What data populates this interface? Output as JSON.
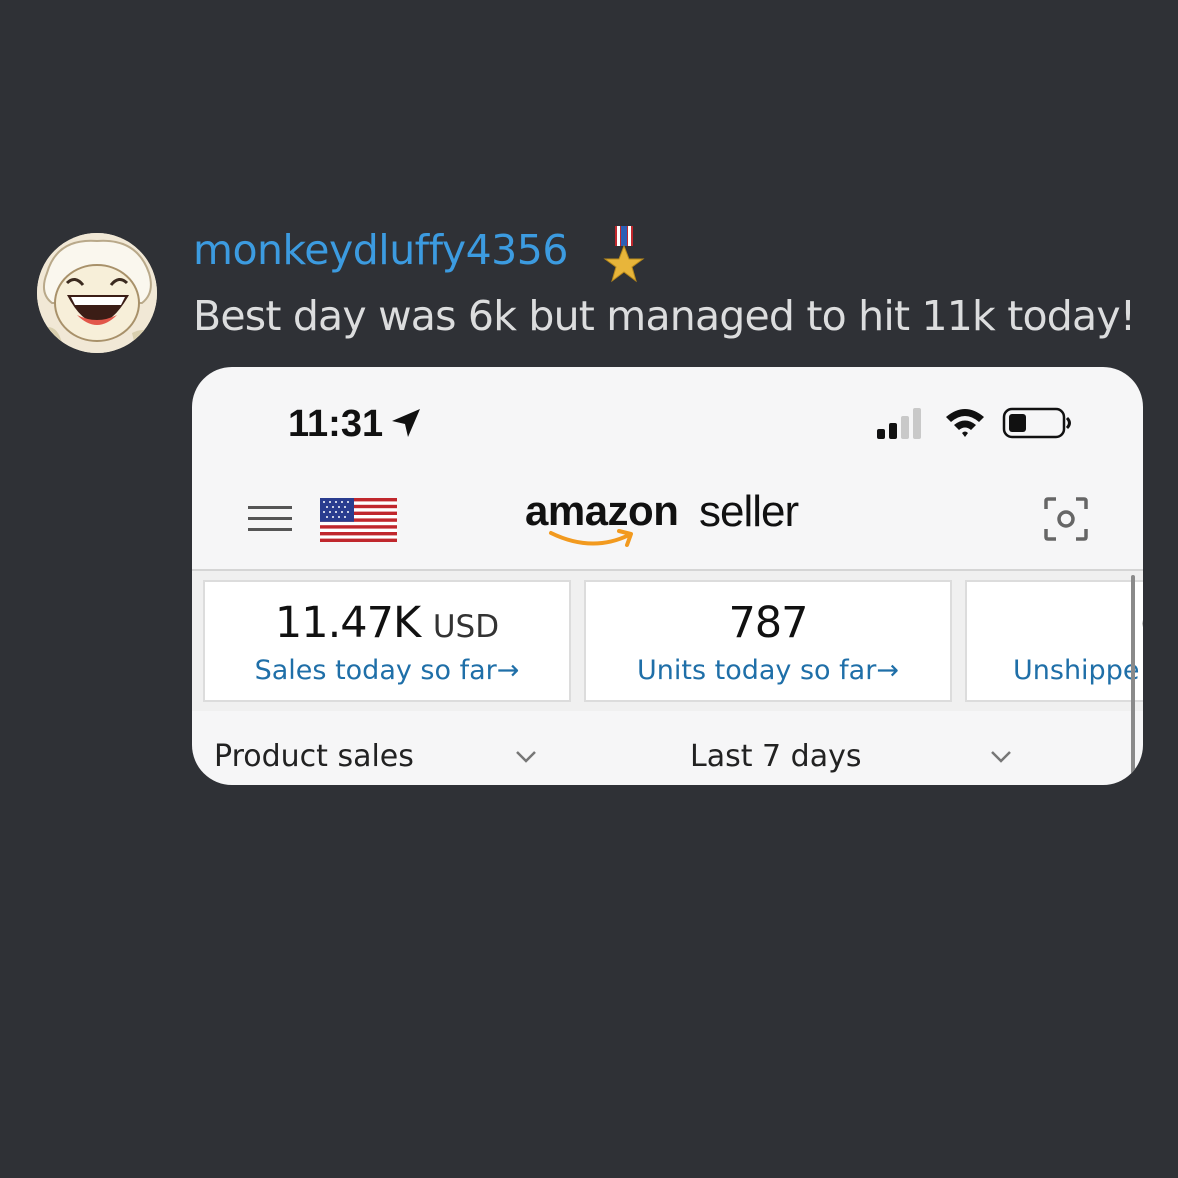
{
  "post": {
    "username": "monkeydluffy4356",
    "badge_icon": "medal-icon",
    "message": "Best day was 6k but managed to hit 11k today!"
  },
  "screenshot": {
    "status_bar": {
      "time": "11:31",
      "icons": [
        "location-arrow-icon",
        "signal-icon",
        "wifi-icon",
        "battery-icon"
      ]
    },
    "header": {
      "brand_primary": "amazon",
      "brand_secondary": "seller",
      "icons": [
        "hamburger-menu-icon",
        "us-flag-icon",
        "scan-icon"
      ]
    },
    "tiles": [
      {
        "value": "11.47K",
        "unit": "USD",
        "link": "Sales today so far"
      },
      {
        "value": "787",
        "unit": "",
        "link": "Units today so far"
      },
      {
        "value": "(",
        "unit": "",
        "link": "Unshippe"
      }
    ],
    "arrow": "→",
    "dropdowns": [
      {
        "label": "Product sales"
      },
      {
        "label": "Last 7 days"
      }
    ],
    "colors": {
      "background": "#2f3136",
      "username": "#3c9be0",
      "link": "#1f6fa8",
      "amazon_orange": "#f29a1f"
    }
  }
}
